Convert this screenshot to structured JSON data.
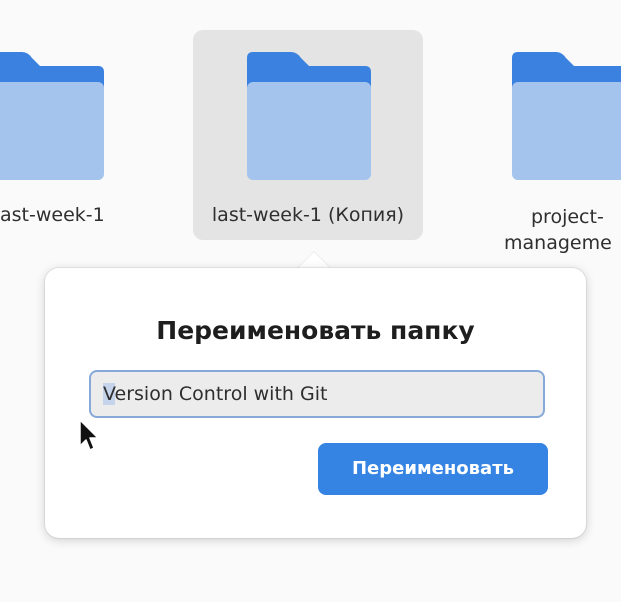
{
  "folders": [
    {
      "label": "ast-week-1"
    },
    {
      "label": "last-week-1 (Копия)"
    },
    {
      "label_line1": "project-",
      "label_line2": "manageme"
    }
  ],
  "popover": {
    "title": "Переименовать папку",
    "input_value_first": "V",
    "input_value_rest": "ersion Control with Git",
    "rename_label": "Переименовать"
  },
  "colors": {
    "folder_back": "#3b82e0",
    "folder_front": "#a4c4ee",
    "accent": "#3584e4",
    "selection_bg": "#e4e4e4"
  }
}
